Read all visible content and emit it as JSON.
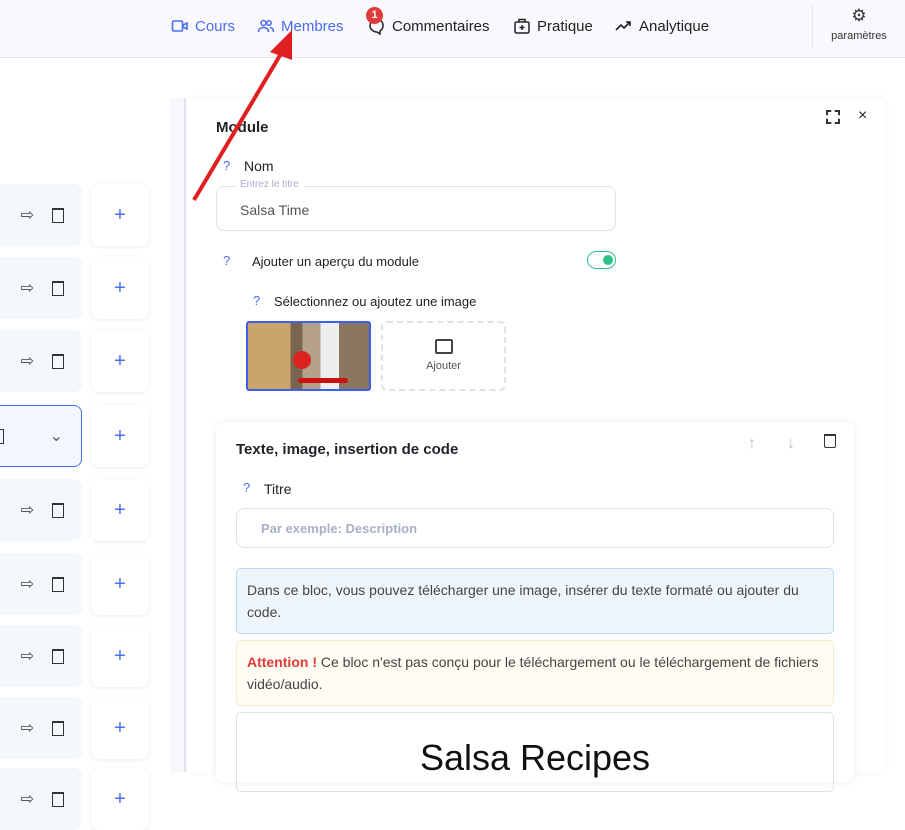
{
  "nav": {
    "items": [
      {
        "label": "Cours",
        "icon": "video-icon"
      },
      {
        "label": "Membres",
        "icon": "users-icon"
      },
      {
        "label": "Commentaires",
        "icon": "comment-icon",
        "badge": "1"
      },
      {
        "label": "Pratique",
        "icon": "briefcase-icon"
      },
      {
        "label": "Analytique",
        "icon": "trend-icon"
      }
    ],
    "settings_label": "paramètres"
  },
  "module": {
    "title": "Module",
    "name_label": "Nom",
    "name_legend": "Entrez le titre",
    "name_value": "Salsa Time",
    "preview_label": "Ajouter un aperçu du module",
    "preview_enabled": true,
    "image_label": "Sélectionnez ou ajoutez une image",
    "add_label": "Ajouter"
  },
  "block": {
    "title": "Texte, image, insertion de code",
    "titre_label": "Titre",
    "titre_placeholder": "Par exemple: Description",
    "info": "Dans ce bloc, vous pouvez télécharger une image, insérer du texte formaté ou ajouter du code.",
    "warning_strong": "Attention !",
    "warning": " Ce bloc n'est pas conçu pour le téléchargement ou le téléchargement de fichiers vidéo/audio.",
    "preview_heading": "Salsa Recipes"
  },
  "colors": {
    "accent": "#4a6cf0",
    "toggle": "#2fc28a",
    "alert": "#e03c3c"
  }
}
